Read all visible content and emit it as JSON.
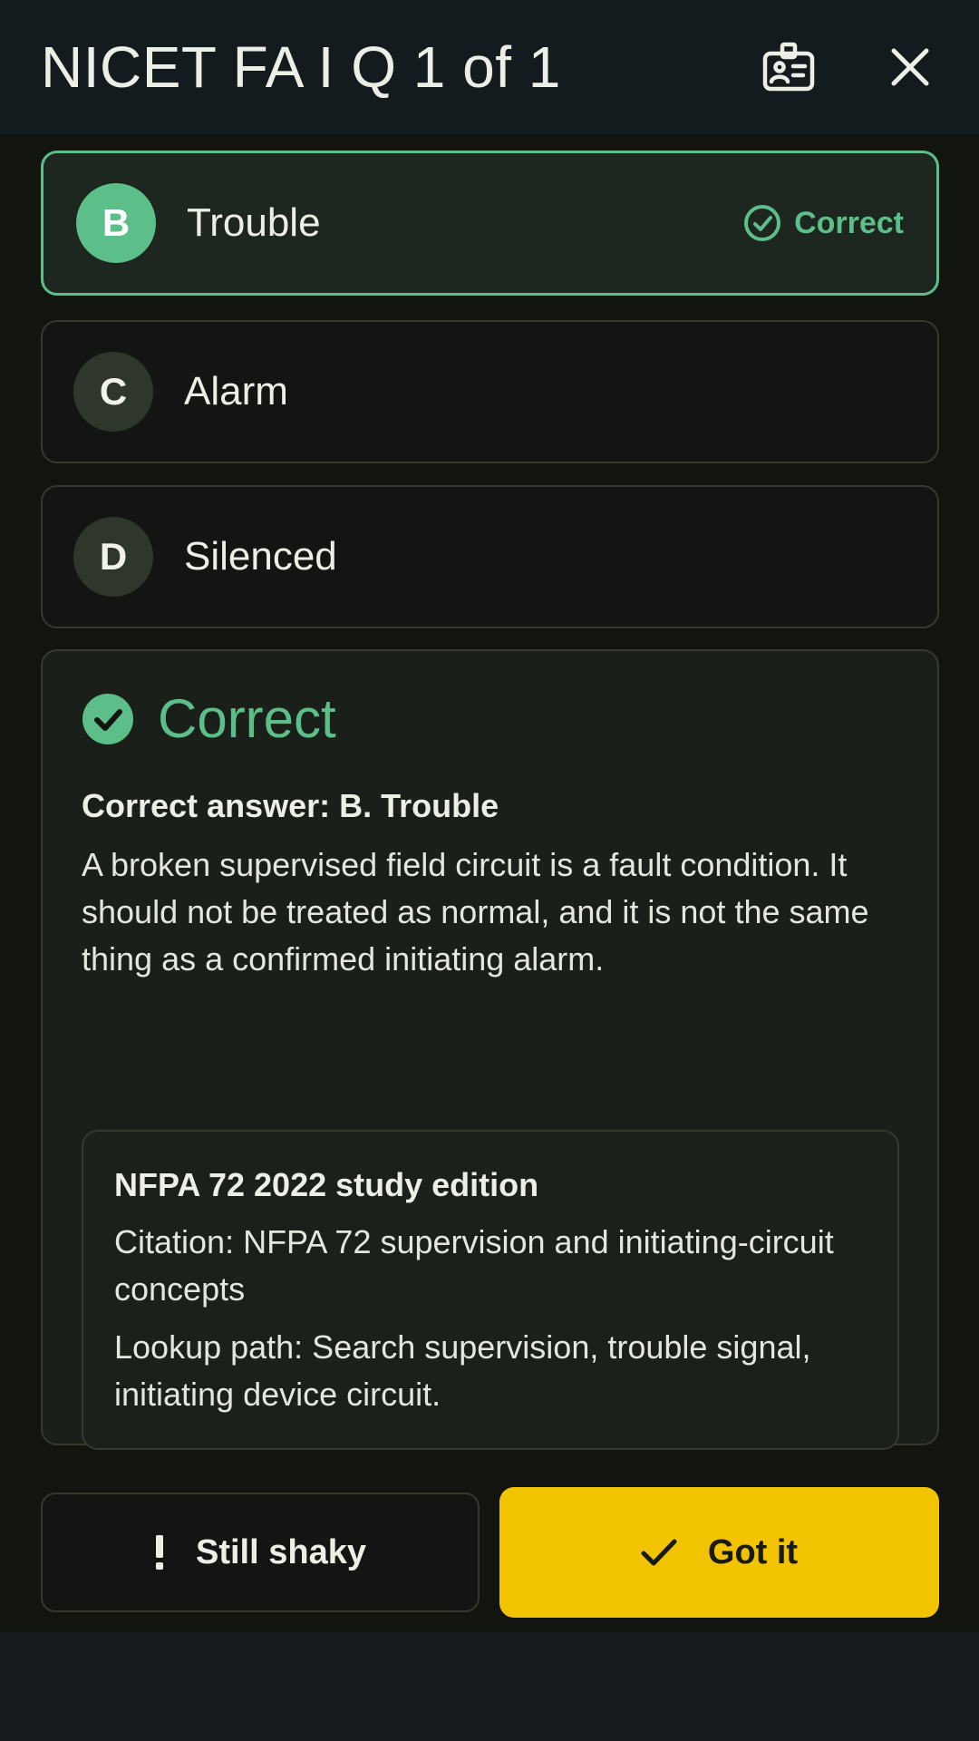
{
  "header": {
    "title": "NICET FA I  Q 1 of 1",
    "badge_icon": "id-badge-icon",
    "close_icon": "close-icon"
  },
  "options": [
    {
      "letter": "B",
      "text": "Trouble",
      "status": "Correct",
      "state": "correct"
    },
    {
      "letter": "C",
      "text": "Alarm",
      "status": "",
      "state": "default"
    },
    {
      "letter": "D",
      "text": "Silenced",
      "status": "",
      "state": "default"
    }
  ],
  "feedback": {
    "verdict": "Correct",
    "answer": "Correct answer: B. Trouble",
    "explanation": "A broken supervised field circuit is a fault condition. It should not be treated as normal, and it is not the same thing as a confirmed initiating alarm.",
    "reference": {
      "title": "NFPA 72 2022 study edition",
      "citation": "Citation: NFPA 72 supervision and initiating-circuit concepts",
      "lookup": "Lookup path: Search supervision, trouble signal, initiating device circuit."
    }
  },
  "actions": {
    "shaky_label": "Still shaky",
    "got_label": "Got it"
  },
  "colors": {
    "accent_green": "#5cbf8a",
    "accent_yellow": "#f2c300",
    "background": "#11140f"
  }
}
